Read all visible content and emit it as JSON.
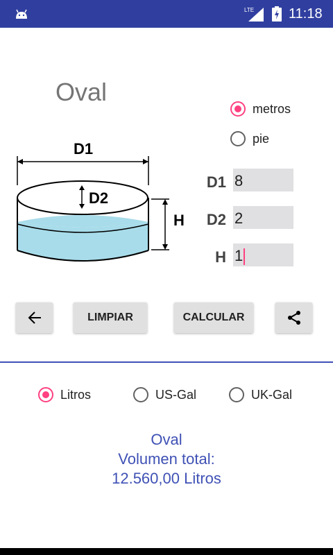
{
  "status_bar": {
    "network": "LTE",
    "time": "11:18"
  },
  "title": "Oval",
  "units": [
    {
      "label": "metros",
      "selected": true
    },
    {
      "label": "pie",
      "selected": false
    }
  ],
  "diagram": {
    "d1_label": "D1",
    "d2_label": "D2",
    "h_label": "H",
    "liquid_color": "#a8dcea"
  },
  "fields": [
    {
      "label": "D1",
      "value": "8"
    },
    {
      "label": "D2",
      "value": "2"
    },
    {
      "label": "H",
      "value": "1"
    }
  ],
  "buttons": {
    "back_icon": "arrow-left-icon",
    "clear": "LIMPIAR",
    "calculate": "CALCULAR",
    "share_icon": "share-icon"
  },
  "output_units": [
    {
      "label": "Litros",
      "selected": true
    },
    {
      "label": "US-Gal",
      "selected": false
    },
    {
      "label": "UK-Gal",
      "selected": false
    }
  ],
  "result": {
    "shape": "Oval",
    "line1": "Volumen total:",
    "line2": "12.560,00 Litros"
  },
  "colors": {
    "primary": "#303f9f",
    "accent": "#ff4081",
    "result_text": "#3f51b5"
  }
}
